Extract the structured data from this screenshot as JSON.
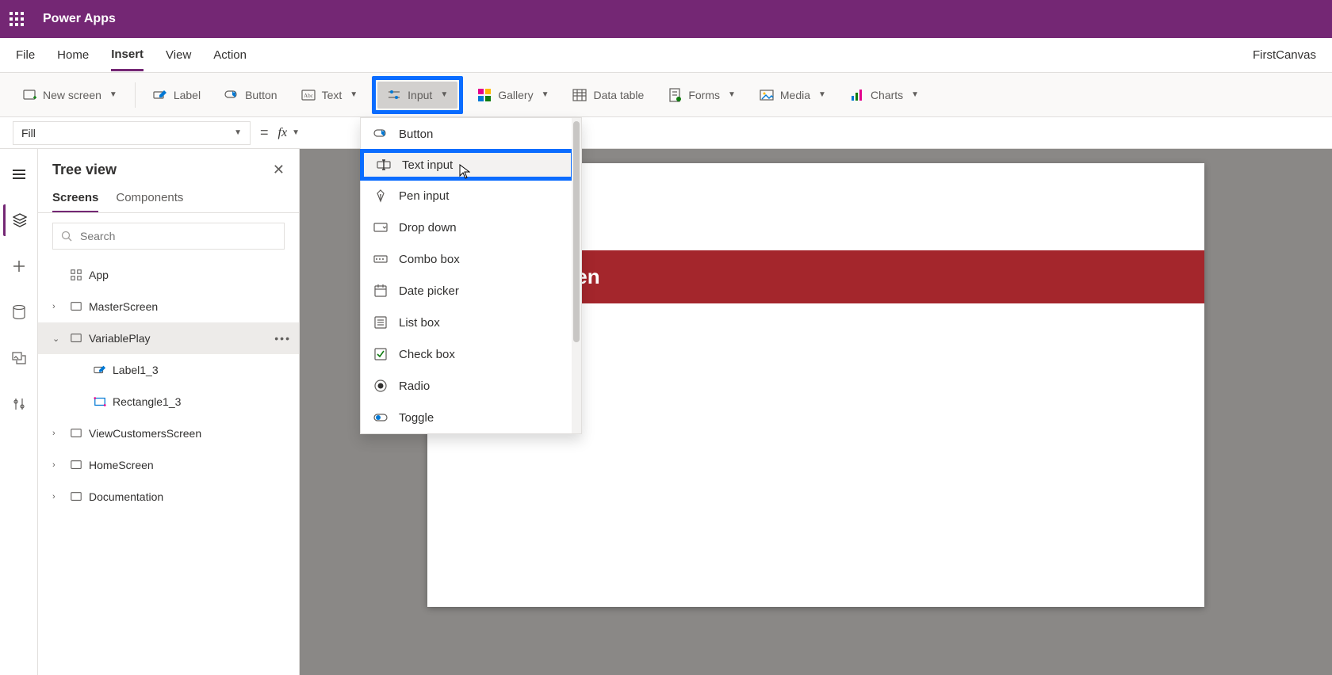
{
  "topbar": {
    "app_title": "Power Apps"
  },
  "menubar": {
    "tabs": [
      "File",
      "Home",
      "Insert",
      "View",
      "Action"
    ],
    "active_index": 2,
    "app_name": "FirstCanvas"
  },
  "ribbon": {
    "items": [
      {
        "label": "New screen",
        "icon": "screen-plus",
        "has_chevron": true
      },
      {
        "label": "Label",
        "icon": "label-edit"
      },
      {
        "label": "Button",
        "icon": "button-tap"
      },
      {
        "label": "Text",
        "icon": "text-abc",
        "has_chevron": true
      },
      {
        "label": "Input",
        "icon": "sliders",
        "has_chevron": true,
        "pressed": true,
        "highlighted": true
      },
      {
        "label": "Gallery",
        "icon": "gallery-grid",
        "has_chevron": true
      },
      {
        "label": "Data table",
        "icon": "data-table"
      },
      {
        "label": "Forms",
        "icon": "forms-page",
        "has_chevron": true
      },
      {
        "label": "Media",
        "icon": "media-image",
        "has_chevron": true
      },
      {
        "label": "Charts",
        "icon": "chart-bars",
        "has_chevron": true
      }
    ]
  },
  "formula": {
    "property": "Fill",
    "fx_label": "fx",
    "value": ""
  },
  "tree": {
    "title": "Tree view",
    "tabs": [
      "Screens",
      "Components"
    ],
    "active_tab": 0,
    "search_placeholder": "Search",
    "nodes": [
      {
        "label": "App",
        "icon": "app-grid",
        "expand": ""
      },
      {
        "label": "MasterScreen",
        "icon": "screen-box",
        "expand": ">"
      },
      {
        "label": "VariablePlay",
        "icon": "screen-box",
        "expand": "v",
        "selected": true,
        "more": true
      },
      {
        "label": "Label1_3",
        "icon": "label-edit",
        "indent": 1
      },
      {
        "label": "Rectangle1_3",
        "icon": "rectangle-shape",
        "indent": 1
      },
      {
        "label": "ViewCustomersScreen",
        "icon": "screen-box",
        "expand": ">"
      },
      {
        "label": "HomeScreen",
        "icon": "screen-box",
        "expand": ">"
      },
      {
        "label": "Documentation",
        "icon": "screen-box",
        "expand": ">"
      }
    ]
  },
  "dropdown": {
    "items": [
      {
        "label": "Button",
        "icon": "button-tap"
      },
      {
        "label": "Text input",
        "icon": "text-input",
        "highlighted": true,
        "hovered": true
      },
      {
        "label": "Pen input",
        "icon": "pen-nib"
      },
      {
        "label": "Drop down",
        "icon": "dropdown-box"
      },
      {
        "label": "Combo box",
        "icon": "combo-box"
      },
      {
        "label": "Date picker",
        "icon": "calendar"
      },
      {
        "label": "List box",
        "icon": "list-box"
      },
      {
        "label": "Check box",
        "icon": "checkbox"
      },
      {
        "label": "Radio",
        "icon": "radio-dot"
      },
      {
        "label": "Toggle",
        "icon": "toggle-switch"
      }
    ]
  },
  "canvas": {
    "title_text": "le of the Screen"
  }
}
